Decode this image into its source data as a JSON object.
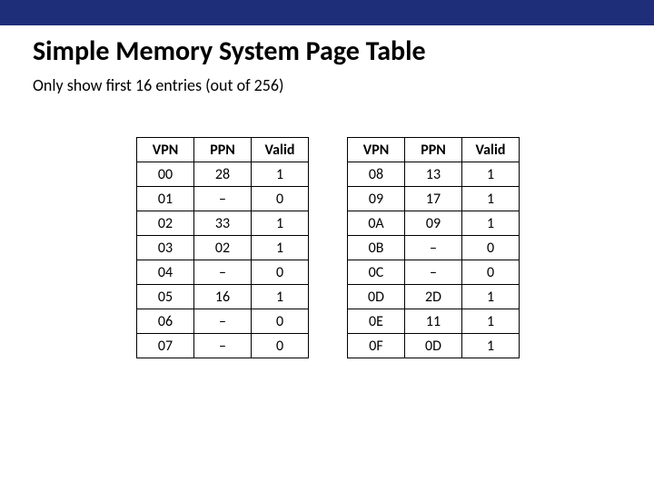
{
  "title": "Simple Memory System Page Table",
  "subtitle": "Only show first 16 entries (out of 256)",
  "headers": {
    "vpn": "VPN",
    "ppn": "PPN",
    "valid": "Valid"
  },
  "left": [
    {
      "vpn": "00",
      "ppn": "28",
      "valid": "1"
    },
    {
      "vpn": "01",
      "ppn": "–",
      "valid": "0"
    },
    {
      "vpn": "02",
      "ppn": "33",
      "valid": "1"
    },
    {
      "vpn": "03",
      "ppn": "02",
      "valid": "1"
    },
    {
      "vpn": "04",
      "ppn": "–",
      "valid": "0"
    },
    {
      "vpn": "05",
      "ppn": "16",
      "valid": "1"
    },
    {
      "vpn": "06",
      "ppn": "–",
      "valid": "0"
    },
    {
      "vpn": "07",
      "ppn": "–",
      "valid": "0"
    }
  ],
  "right": [
    {
      "vpn": "08",
      "ppn": "13",
      "valid": "1"
    },
    {
      "vpn": "09",
      "ppn": "17",
      "valid": "1"
    },
    {
      "vpn": "0A",
      "ppn": "09",
      "valid": "1"
    },
    {
      "vpn": "0B",
      "ppn": "–",
      "valid": "0"
    },
    {
      "vpn": "0C",
      "ppn": "–",
      "valid": "0"
    },
    {
      "vpn": "0D",
      "ppn": "2D",
      "valid": "1"
    },
    {
      "vpn": "0E",
      "ppn": "11",
      "valid": "1"
    },
    {
      "vpn": "0F",
      "ppn": "0D",
      "valid": "1"
    }
  ]
}
